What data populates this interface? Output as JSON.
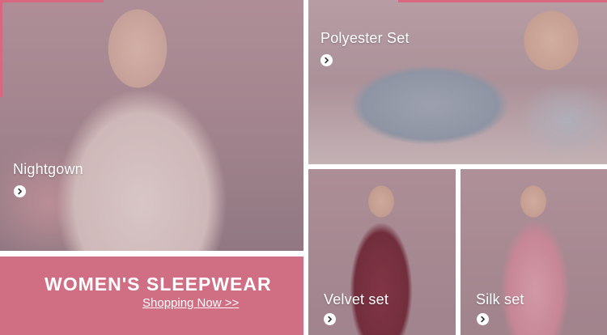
{
  "tiles": {
    "nightgown": {
      "label": "Nightgown"
    },
    "polyester": {
      "label": "Polyester Set"
    },
    "velvet": {
      "label": "Velvet set"
    },
    "silk": {
      "label": "Silk set"
    }
  },
  "banner": {
    "title": "WOMEN'S SLEEPWEAR",
    "link_label": "Shopping Now  >>"
  },
  "colors": {
    "accent": "#d9677f",
    "banner_bg": "#d06e84",
    "label_text": "#ffffff"
  },
  "icons": {
    "tile_arrow": "chevron-right-icon"
  }
}
